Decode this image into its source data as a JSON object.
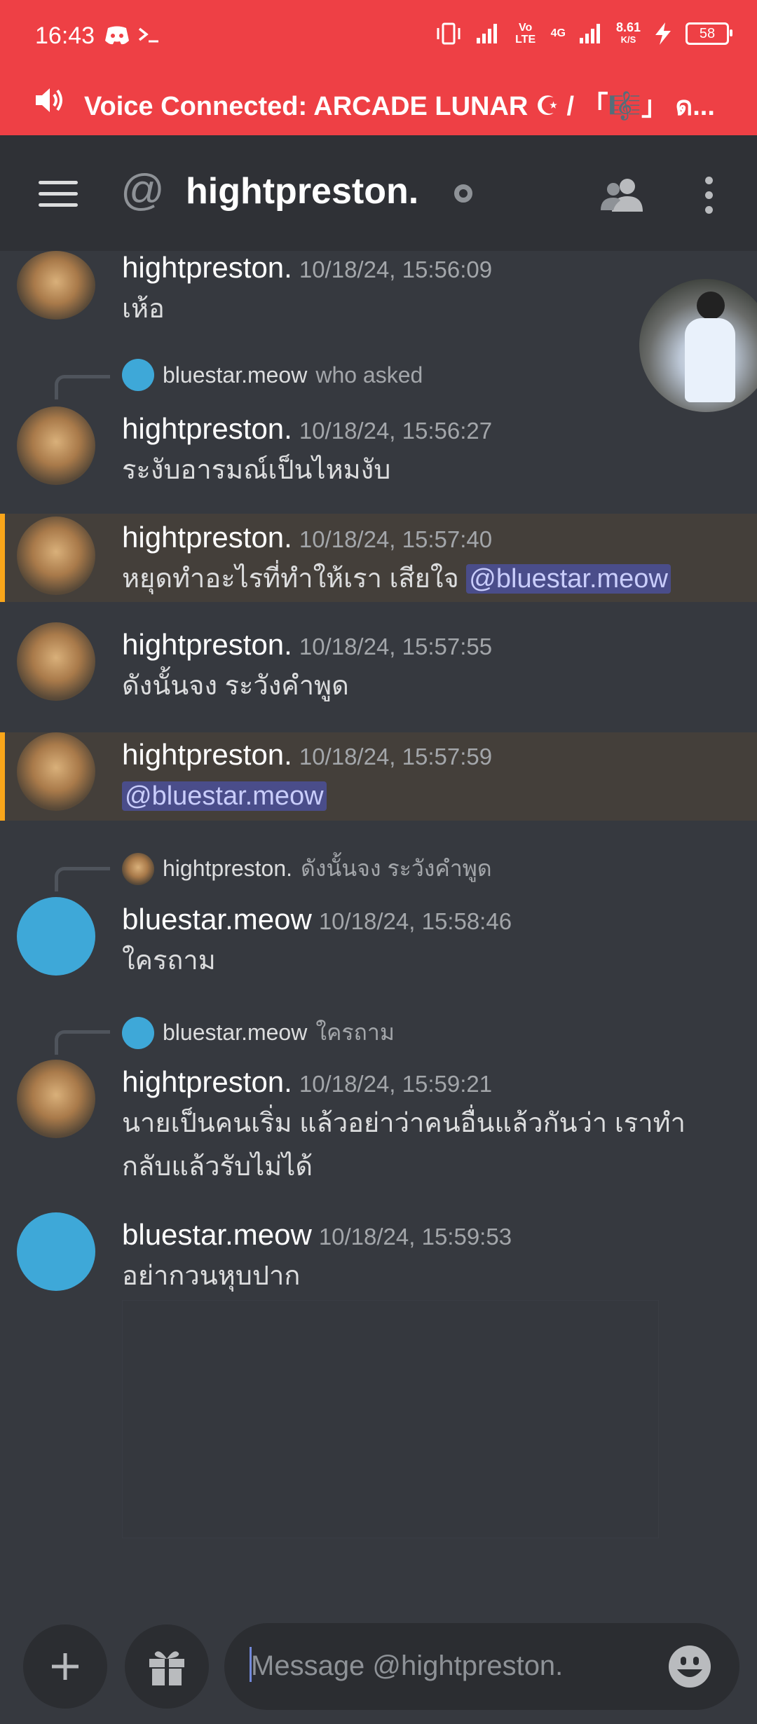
{
  "status_bar": {
    "time": "16:43",
    "volte": "Vo LTE",
    "network": "4G",
    "speed": "8.61",
    "speed_unit": "K/S",
    "battery": "58"
  },
  "voice_banner": {
    "text": "Voice Connected: ARCADE LUNAR ☪ / 「🎼」 ด..."
  },
  "header": {
    "at_symbol": "@",
    "title": "hightpreston."
  },
  "messages": [
    {
      "author": "hightpreston.",
      "timestamp": "10/18/24, 15:56:09",
      "text": "เห้อ"
    },
    {
      "author": "hightpreston.",
      "timestamp": "10/18/24, 15:56:27",
      "text": "ระงับอารมณ์เป็นไหมงับ",
      "reply": {
        "author": "bluestar.meow",
        "text": "who asked"
      }
    },
    {
      "author": "hightpreston.",
      "timestamp": "10/18/24, 15:57:40",
      "text": "หยุดทำอะไรที่ทำให้เรา เสียใจ ",
      "mention": "@bluestar.meow"
    },
    {
      "author": "hightpreston.",
      "timestamp": "10/18/24, 15:57:55",
      "text": "ดังนั้นจง ระวังคำพูด"
    },
    {
      "author": "hightpreston.",
      "timestamp": "10/18/24, 15:57:59",
      "mention": "@bluestar.meow"
    },
    {
      "author": "bluestar.meow",
      "timestamp": "10/18/24, 15:58:46",
      "text": "ใครถาม",
      "reply": {
        "author": "hightpreston.",
        "text": "ดังนั้นจง ระวังคำพูด"
      }
    },
    {
      "author": "hightpreston.",
      "timestamp": "10/18/24, 15:59:21",
      "text": "นายเป็นคนเริ่ม แล้วอย่าว่าคนอื่นแล้วกันว่า เราทำกลับแล้วรับไม่ได้",
      "reply": {
        "author": "bluestar.meow",
        "text": "ใครถาม"
      }
    },
    {
      "author": "bluestar.meow",
      "timestamp": "10/18/24, 15:59:53",
      "text": "อย่ากวนหุบปาก"
    }
  ],
  "composer": {
    "placeholder": "Message @hightpreston."
  },
  "colors": {
    "banner": "#ee4045",
    "background": "#36393f",
    "header": "#2f3136",
    "mention_highlight": "#443f3a",
    "mention_bar": "#faa61a",
    "bluestar_avatar": "#3ea8d8"
  }
}
